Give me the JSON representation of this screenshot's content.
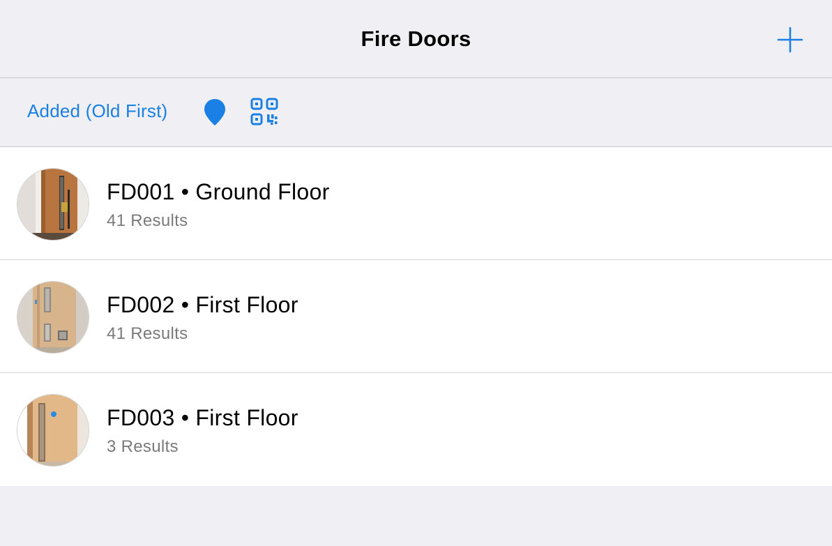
{
  "header": {
    "title": "Fire Doors",
    "add_icon": "plus-icon"
  },
  "toolbar": {
    "sort_label": "Added (Old First)",
    "location_icon": "location-pin-icon",
    "qr_icon": "qr-code-icon"
  },
  "colors": {
    "accent": "#1a80e6",
    "background": "#efeff4",
    "row_background": "#ffffff",
    "subtitle": "#7a7a7a"
  },
  "doors": [
    {
      "code": "FD001",
      "separator": "•",
      "location": "Ground Floor",
      "title": "FD001 • Ground Floor",
      "results": "41 Results",
      "thumbnail_icon": "door-photo-thumbnail"
    },
    {
      "code": "FD002",
      "separator": "•",
      "location": "First Floor",
      "title": "FD002 • First Floor",
      "results": "41 Results",
      "thumbnail_icon": "door-photo-thumbnail"
    },
    {
      "code": "FD003",
      "separator": "•",
      "location": "First Floor",
      "title": "FD003 • First Floor",
      "results": "3 Results",
      "thumbnail_icon": "door-photo-thumbnail"
    }
  ]
}
